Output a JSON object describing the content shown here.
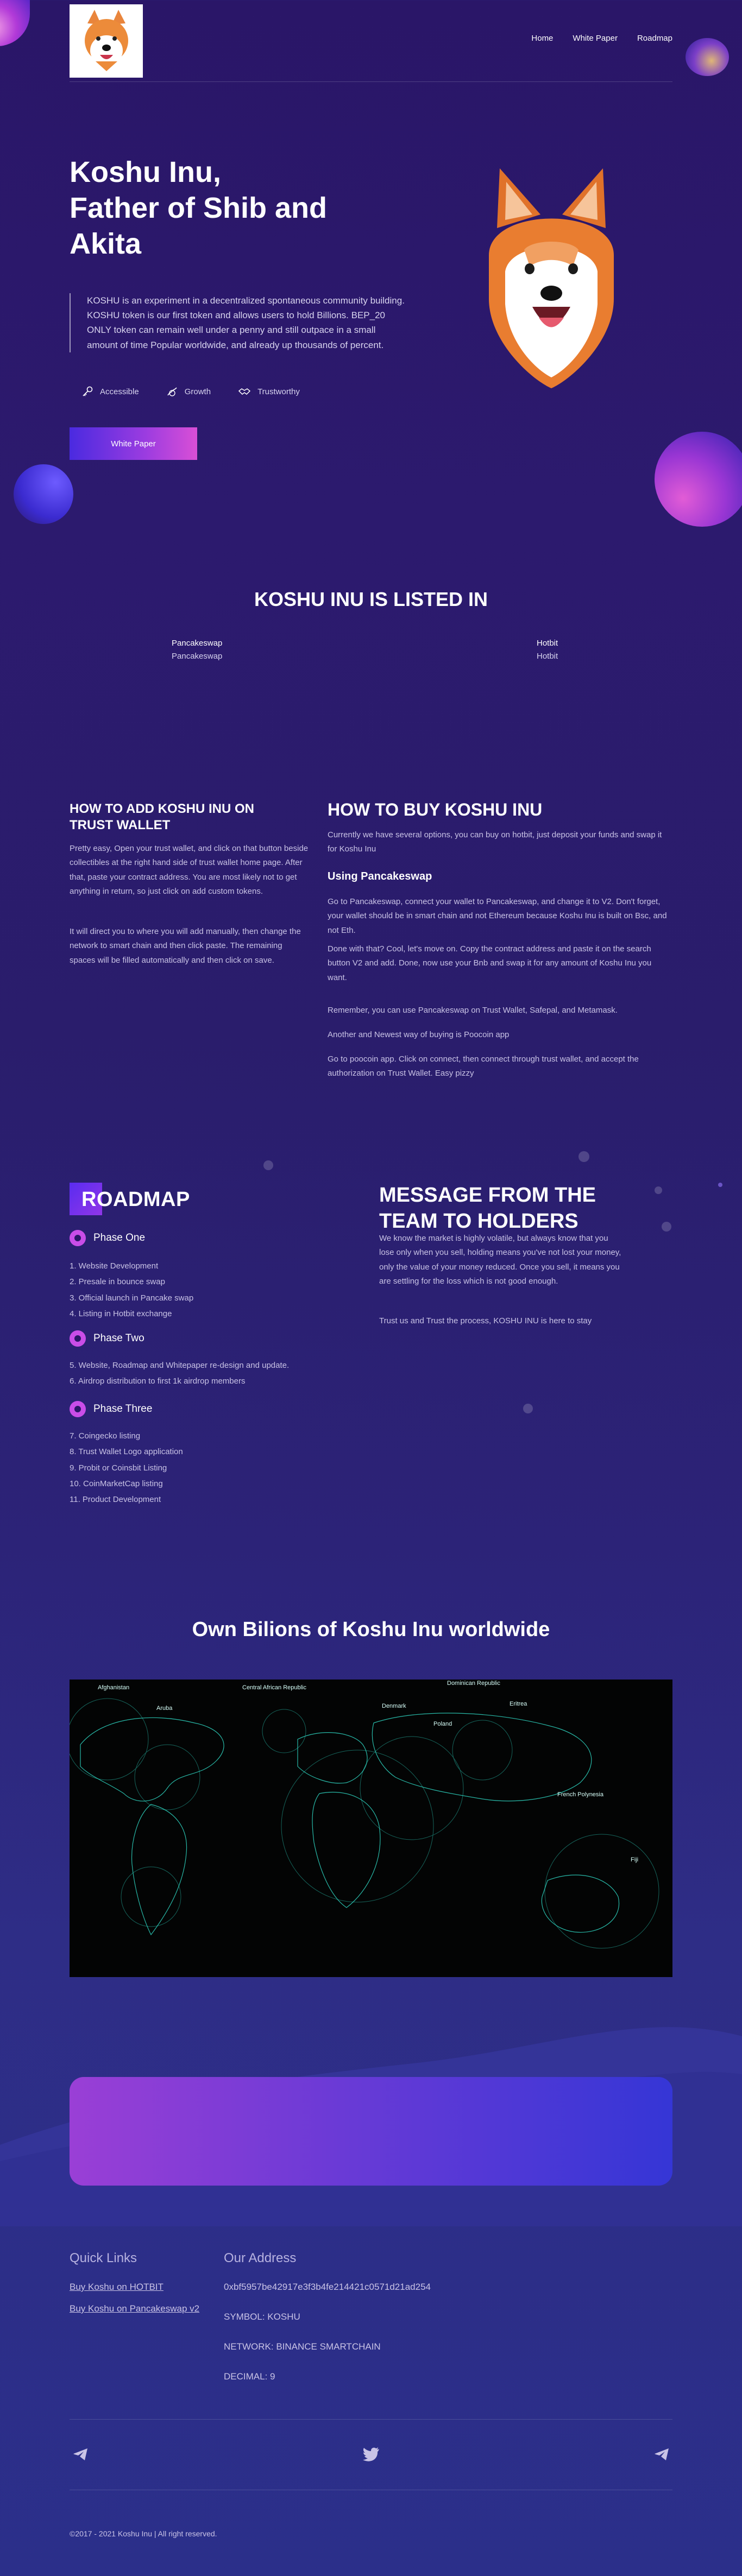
{
  "header": {
    "logo_alt": "Koshu Inu logo",
    "nav": [
      "Home",
      "White Paper",
      "Roadmap"
    ]
  },
  "hero": {
    "title_lines": [
      "Koshu Inu,",
      "Father of Shib and",
      "Akita"
    ],
    "description": "KOSHU is an experiment in a decentralized spontaneous community building. KOSHU token is our first token and allows users to hold Billions. BEP_20 ONLY token can remain well under a penny and still outpace in a small amount of time Popular worldwide, and already up thousands of percent.",
    "features": [
      {
        "icon": "key-icon",
        "label": "Accessible"
      },
      {
        "icon": "growth-icon",
        "label": "Growth"
      },
      {
        "icon": "handshake-icon",
        "label": "Trustworthy"
      }
    ],
    "button": "White Paper"
  },
  "listed": {
    "title": "KOSHU INU IS LISTED IN",
    "items": [
      {
        "alt": "Pancakeswap",
        "name": "Pancakeswap"
      },
      {
        "alt": "Hotbit",
        "name": "Hotbit"
      }
    ]
  },
  "how_to_add": {
    "title": "HOW TO ADD KOSHU INU ON TRUST WALLET",
    "p1": "Pretty easy, Open your trust wallet, and click on that button beside collectibles at the right hand side of trust wallet home page. After that, paste your contract address. You are most likely not to get anything in return, so just click on add custom tokens.",
    "p2": "It will direct you to where you will add manually, then change the network to smart chain and then click paste. The remaining spaces will be filled automatically and then click on save."
  },
  "how_to_buy": {
    "title": "HOW TO BUY KOSHU INU",
    "intro": "Currently we have several options, you can buy on hotbit, just deposit your funds and swap it for Koshu Inu",
    "subtitle": "Using Pancakeswap",
    "p1": "Go to Pancakeswap, connect your wallet to Pancakeswap, and change it to V2. Don't forget, your wallet should be in smart chain and not Ethereum because Koshu Inu is built on Bsc, and not Eth.",
    "p2": "Done with that? Cool, let's move on. Copy the contract address and paste it on the search button V2 and add. Done, now use your Bnb and swap it for any amount of Koshu Inu you want.",
    "p3": "Remember, you can use Pancakeswap on Trust Wallet, Safepal, and Metamask.",
    "p4": "Another and Newest way of buying is Poocoin app",
    "p5": "Go to poocoin app. Click on connect, then connect through trust wallet, and accept the authorization on Trust Wallet. Easy pizzy"
  },
  "roadmap": {
    "title": "ROADMAP",
    "phases": [
      {
        "name": "Phase One",
        "items": [
          "1. Website Development",
          "2. Presale in bounce swap",
          "3. Official launch in Pancake swap",
          "4. Listing in Hotbit exchange"
        ]
      },
      {
        "name": "Phase Two",
        "items": [
          "5. Website, Roadmap and Whitepaper re-design and update.",
          "6. Airdrop distribution to first 1k airdrop members"
        ]
      },
      {
        "name": "Phase Three",
        "items": [
          "7. Coingecko listing",
          "8. Trust Wallet Logo application",
          "9. Probit or Coinsbit Listing",
          "10. CoinMarketCap listing",
          "11. Product Development"
        ]
      }
    ]
  },
  "message": {
    "title": "MESSAGE FROM THE TEAM TO HOLDERS",
    "p1": "We know the market is highly volatile, but always know that you lose only when you sell, holding means you've not lost your money, only the value of your money reduced. Once you sell, it means you are settling for the loss which is not good enough.",
    "p2": "Trust us and Trust the process, KOSHU INU is here to stay"
  },
  "world": {
    "title": "Own Bilions of Koshu Inu worldwide",
    "map_labels": [
      "Afghanistan",
      "Aruba",
      "Central African Republic",
      "Denmark",
      "Dominican Republic",
      "Poland",
      "Eritrea",
      "French Polynesia",
      "Fiji"
    ]
  },
  "footer": {
    "quick_links_title": "Quick Links",
    "quick_links": [
      "Buy Koshu on HOTBIT",
      "Buy Koshu on Pancakeswap v2"
    ],
    "address_title": "Our Address",
    "address_lines": [
      "0xbf5957be42917e3f3b4fe214421c0571d21ad254",
      "SYMBOL: KOSHU",
      "NETWORK: BINANCE SMARTCHAIN",
      "DECIMAL: 9"
    ],
    "socials": [
      "telegram-icon",
      "twitter-icon",
      "telegram-icon"
    ],
    "copyright": "©2017 - 2021 Koshu Inu | All right reserved."
  }
}
